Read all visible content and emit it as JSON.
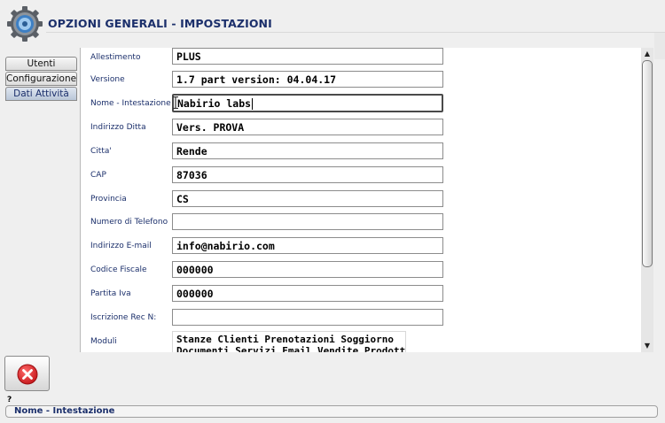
{
  "window": {
    "title": "OPZIONI GENERALI - IMPOSTAZIONI",
    "logo_icon": "gear-icon"
  },
  "tabs": [
    {
      "label": "Utenti",
      "active": false
    },
    {
      "label": "Configurazione",
      "active": false
    },
    {
      "label": "Dati Attività",
      "active": true
    }
  ],
  "fields": [
    {
      "label": "Allestimento",
      "value": "PLUS"
    },
    {
      "label": "Versione",
      "value": "1.7 part version: 04.04.17"
    },
    {
      "label": "Nome - Intestazione",
      "value": "Nabirio labs",
      "focused": true
    },
    {
      "label": "Indirizzo Ditta",
      "value": "Vers. PROVA"
    },
    {
      "label": "Citta'",
      "value": "Rende"
    },
    {
      "label": "CAP",
      "value": "87036"
    },
    {
      "label": "Provincia",
      "value": "CS"
    },
    {
      "label": "Numero di Telefono",
      "value": ""
    },
    {
      "label": "Indirizzo E-mail",
      "value": "info@nabirio.com"
    },
    {
      "label": "Codice Fiscale",
      "value": "000000"
    },
    {
      "label": "Partita Iva",
      "value": "000000"
    },
    {
      "label": "Iscrizione Rec N:",
      "value": ""
    }
  ],
  "modules": {
    "label": "Moduli",
    "line1": "Stanze Clienti Prenotazioni Soggiorno",
    "line2": "Documenti Servizi Email Vendite Prodotti"
  },
  "scrollbar": {
    "up_icon": "arrow-up-icon",
    "down_icon": "arrow-down-icon"
  },
  "footer": {
    "close_icon": "close-icon",
    "help_text": "?",
    "status_text": "Nome - Intestazione"
  },
  "colors": {
    "label": "#1b2f6b",
    "close_red": "#e0262a"
  }
}
